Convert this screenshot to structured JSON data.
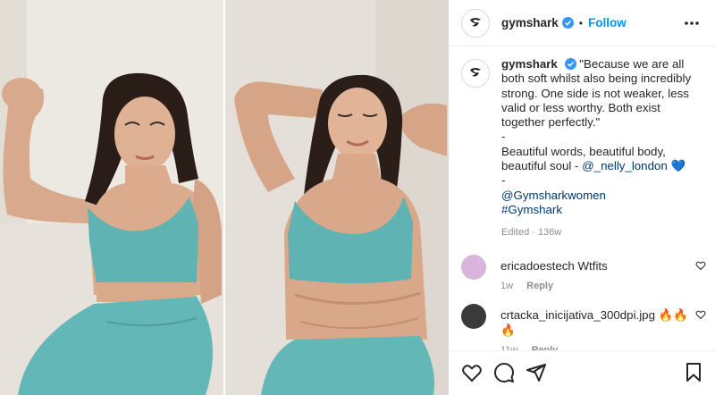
{
  "header": {
    "username": "gymshark",
    "separator": "•",
    "follow_label": "Follow",
    "more_icon": "more-horizontal-icon"
  },
  "caption": {
    "username": "gymshark",
    "text": "\"Because we are all both soft whilst also being incredibly strong. One side is not weaker, less valid or less worthy. Both exist together perfectly.\"",
    "dash1": "-",
    "line2": "Beautiful words, beautiful body, beautiful soul -",
    "mention": "@_nelly_london",
    "emoji": "💙",
    "dash2": "-",
    "mention2": "@Gymsharkwomen",
    "hashtag": "#Gymshark",
    "edited": "Edited",
    "edited_sep": "·",
    "age": "136w"
  },
  "comments": [
    {
      "username": "ericadoestech",
      "text": "Wtfits",
      "age": "1w",
      "reply": "Reply"
    },
    {
      "username": "crtacka_inicijativa_300dpi.jpg",
      "text": "🔥🔥🔥",
      "age": "11w",
      "reply": "Reply"
    }
  ],
  "actions": [
    "heart-icon",
    "comment-icon",
    "share-icon",
    "bookmark-icon"
  ],
  "colors": {
    "follow": "#0095f6",
    "verified": "#3897f0",
    "muted": "#8e8e8e",
    "text": "#262626",
    "outfit": "#5fb3b3"
  }
}
